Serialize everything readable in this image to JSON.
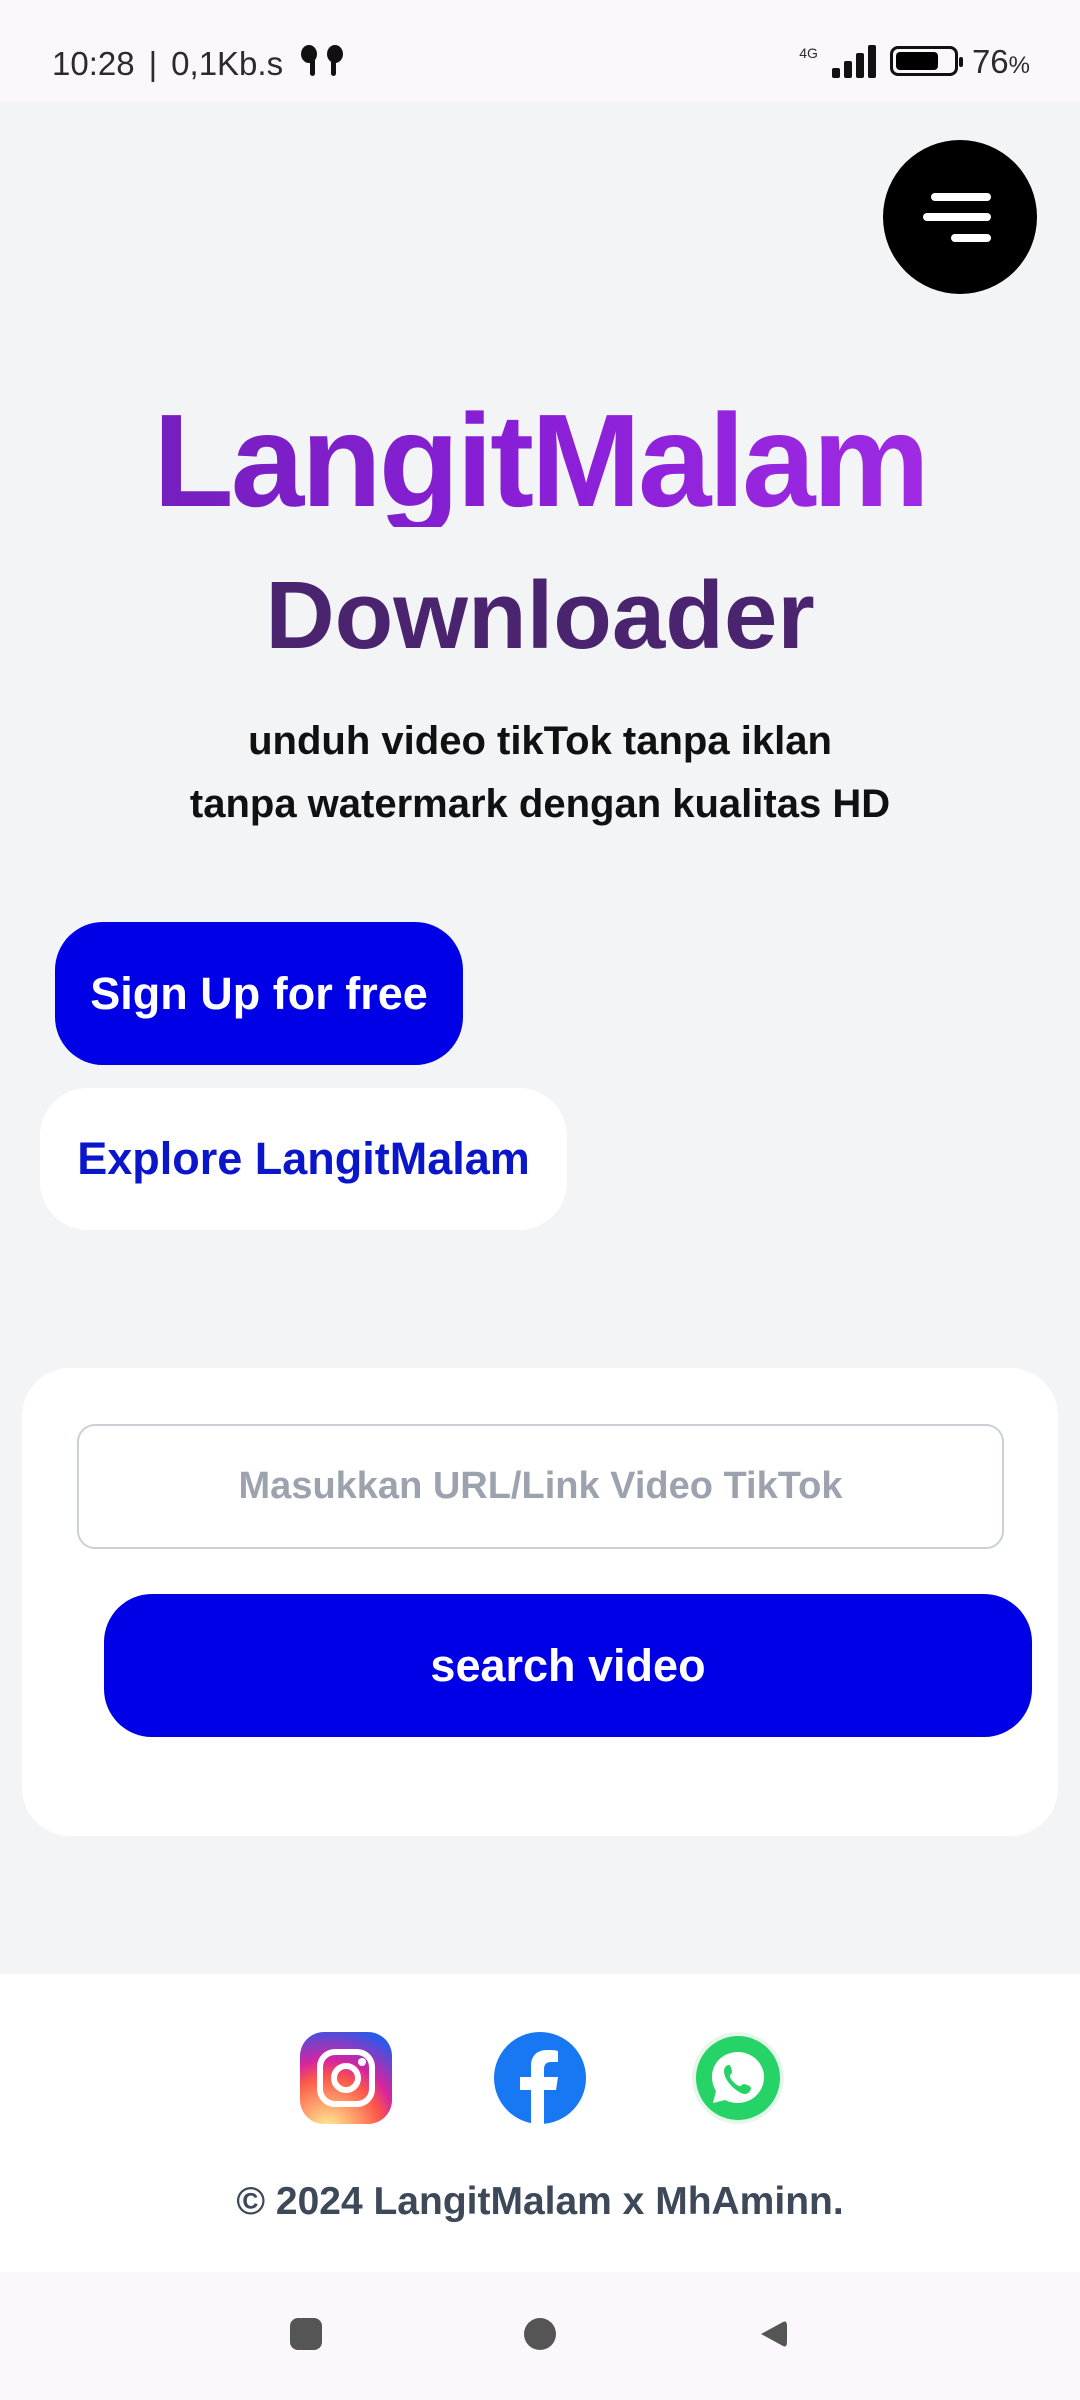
{
  "status_bar": {
    "time": "10:28",
    "speed": "0,1Kb.s",
    "network": "4G",
    "battery": "76",
    "battery_unit": "%",
    "battery_level": 0.76
  },
  "header": {
    "menu_icon": "hamburger-menu-icon"
  },
  "hero": {
    "title": "LangitMalam",
    "subtitle": "Downloader",
    "tagline_line1": "unduh video tikTok tanpa iklan",
    "tagline_line2": "tanpa watermark dengan kualitas HD"
  },
  "actions": {
    "signup_label": "Sign Up for free",
    "explore_label": "Explore LangitMalam"
  },
  "search": {
    "placeholder": "Masukkan URL/Link Video TikTok",
    "value": "",
    "button_label": "search video"
  },
  "footer": {
    "social": [
      "instagram-icon",
      "facebook-icon",
      "whatsapp-icon"
    ],
    "copyright": "© 2024 LangitMalam x MhAminn."
  },
  "colors": {
    "primary": "#0000e6",
    "title_gradient_start": "#6d1fb4",
    "title_gradient_end": "#a72fe8",
    "subtitle": "#4b246f"
  }
}
